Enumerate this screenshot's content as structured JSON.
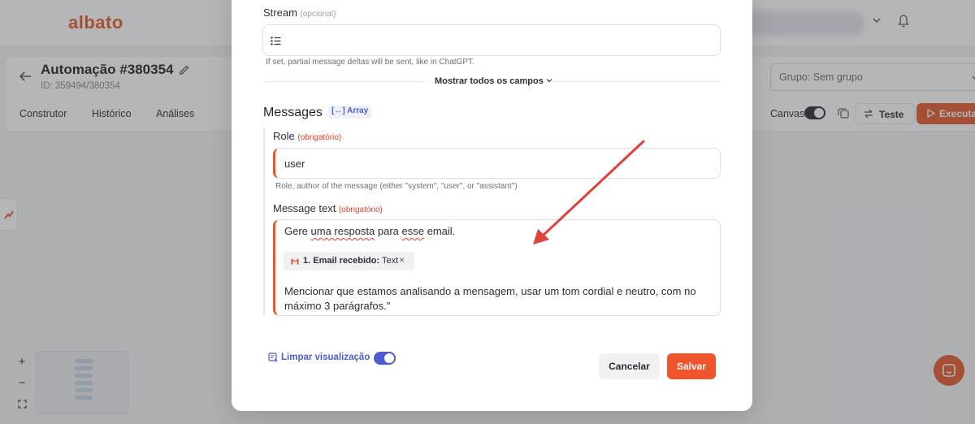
{
  "app": {
    "logo_text": "albato",
    "brand_color": "#e5592c"
  },
  "automation": {
    "title": "Automação #380354",
    "id_text": "ID: 359494/380354",
    "tabs": [
      "Construtor",
      "Histórico",
      "Análises"
    ],
    "group_select": "Grupo: Sem grupo",
    "canvas_label": "Canvas",
    "test_button": "Teste",
    "execute_button": "Executar"
  },
  "modal": {
    "stream": {
      "label": "Stream",
      "optional_tag": "(opcional)",
      "hint": "If set, partial message deltas will be sent, like in ChatGPT."
    },
    "show_all_fields": "Mostrar todos os campos",
    "messages": {
      "title": "Messages",
      "badge": "Array",
      "role": {
        "label": "Role",
        "required_tag": "(obrigatório)",
        "value": "user",
        "hint": "Role, author of the message (either \"system\", \"user\", or \"assistant\")"
      },
      "message_text": {
        "label": "Message text",
        "required_tag": "(obrigatório)",
        "line1_parts": [
          "Gere ",
          "uma resposta",
          " para ",
          "esse",
          " email."
        ],
        "chip": {
          "bold": "1. Email recebido:",
          "rest": "Text",
          "close": "×"
        },
        "line3": "Mencionar que estamos analisando a mensagem, usar um tom cordial e neutro, com no",
        "line4": "máximo 3 parágrafos.\""
      }
    },
    "clear_view_label": "Limpar visualização",
    "cancel_button": "Cancelar",
    "save_button": "Salvar"
  },
  "colors": {
    "accent_orange": "#f0542c",
    "link_blue": "#4f5bd5",
    "annotation_arrow": "#e0413a"
  }
}
